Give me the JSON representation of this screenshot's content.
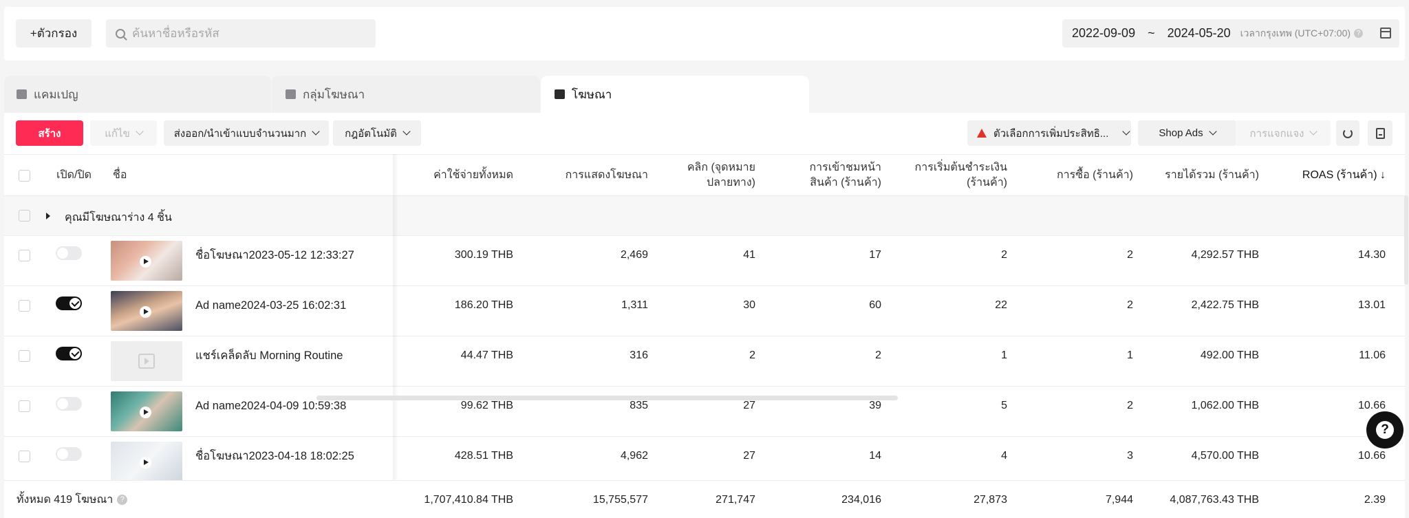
{
  "filter": {
    "add_filter_label": "+ตัวกรอง",
    "search_placeholder": "ค้นหาชื่อหรือรหัส",
    "date_start": "2022-09-09",
    "date_sep": "~",
    "date_end": "2024-05-20",
    "timezone": "เวลากรุงเทพ (UTC+07:00)"
  },
  "tabs": [
    {
      "label": "แคมเปญ"
    },
    {
      "label": "กลุ่มโฆษณา"
    },
    {
      "label": "โฆษณา"
    }
  ],
  "toolbar": {
    "create": "สร้าง",
    "edit": "แก้ไข",
    "bulk": "ส่งออก/นำเข้าแบบจำนวนมาก",
    "auto_rules": "กฎอัตโนมัติ",
    "optimize": "ตัวเลือกการเพิ่มประสิทธิ...",
    "shop_ads": "Shop Ads",
    "distribute": "การแจกแจง"
  },
  "columns": {
    "onoff": "เปิด/ปิด",
    "name": "ชื่อ",
    "spend": "ค่าใช้จ่ายทั้งหมด",
    "impressions": "การแสดงโฆษณา",
    "clicks_1": "คลิก (จุดหมาย",
    "clicks_2": "ปลายทาง)",
    "pdp_1": "การเข้าชมหน้า",
    "pdp_2": "สินค้า (ร้านค้า)",
    "checkout_1": "การเริ่มต้นชำระเงิน",
    "checkout_2": "(ร้านค้า)",
    "purchases": "การซื้อ (ร้านค้า)",
    "revenue": "รายได้รวม (ร้านค้า)",
    "roas": "ROAS (ร้านค้า) ↓"
  },
  "draft_text": "คุณมีโฆษณาร่าง 4 ชิ้น",
  "rows": [
    {
      "name": "ชื่อโฆษณา2023-05-12 12:33:27",
      "on": false,
      "spend": "300.19 THB",
      "impressions": "2,469",
      "clicks": "41",
      "pdp": "17",
      "checkout": "2",
      "purchases": "2",
      "revenue": "4,292.57 THB",
      "roas": "14.30"
    },
    {
      "name": "Ad name2024-03-25 16:02:31",
      "on": true,
      "spend": "186.20 THB",
      "impressions": "1,311",
      "clicks": "30",
      "pdp": "60",
      "checkout": "22",
      "purchases": "2",
      "revenue": "2,422.75 THB",
      "roas": "13.01"
    },
    {
      "name": "แชร์เคล็ดลับ Morning Routine",
      "on": true,
      "spend": "44.47 THB",
      "impressions": "316",
      "clicks": "2",
      "pdp": "2",
      "checkout": "1",
      "purchases": "1",
      "revenue": "492.00 THB",
      "roas": "11.06"
    },
    {
      "name": "Ad name2024-04-09 10:59:38",
      "on": false,
      "spend": "99.62 THB",
      "impressions": "835",
      "clicks": "27",
      "pdp": "39",
      "checkout": "5",
      "purchases": "2",
      "revenue": "1,062.00 THB",
      "roas": "10.66"
    },
    {
      "name": "ชื่อโฆษณา2023-04-18 18:02:25",
      "on": false,
      "spend": "428.51 THB",
      "impressions": "4,962",
      "clicks": "27",
      "pdp": "14",
      "checkout": "4",
      "purchases": "3",
      "revenue": "4,570.00 THB",
      "roas": "10.66"
    }
  ],
  "totals": {
    "label": "ทั้งหมด 419 โฆษณา",
    "spend": "1,707,410.84 THB",
    "impressions": "15,755,577",
    "clicks": "271,747",
    "pdp": "234,016",
    "checkout": "27,873",
    "purchases": "7,944",
    "revenue": "4,087,763.43 THB",
    "roas": "2.39"
  },
  "colors": {
    "accent": "#fe2c55",
    "toggle_on": "#121212",
    "warning": "#e0322b"
  }
}
